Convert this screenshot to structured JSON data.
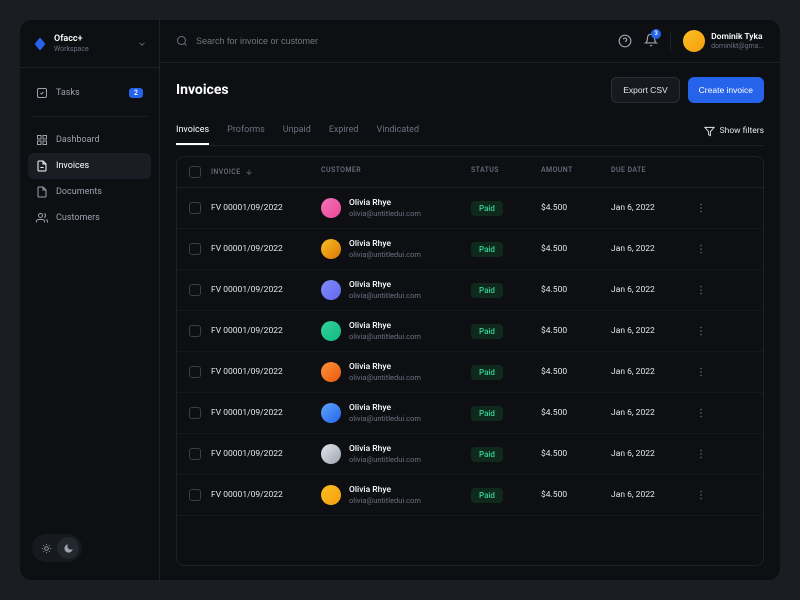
{
  "workspace": {
    "name": "Ofacc+",
    "label": "Workspace"
  },
  "sidebar": {
    "tasks_label": "Tasks",
    "tasks_badge": "2",
    "items": [
      {
        "label": "Dashboard"
      },
      {
        "label": "Invoices"
      },
      {
        "label": "Documents"
      },
      {
        "label": "Customers"
      }
    ]
  },
  "search": {
    "placeholder": "Search for invoice or customer"
  },
  "notifications": {
    "count": "3"
  },
  "user": {
    "name": "Dominik Tyka",
    "email": "dominikt@gma..."
  },
  "page": {
    "title": "Invoices"
  },
  "buttons": {
    "export": "Export CSV",
    "create": "Create invoice",
    "filters": "Show filters"
  },
  "tabs": [
    "Invoices",
    "Proforms",
    "Unpaid",
    "Expired",
    "Vindicated"
  ],
  "table": {
    "headers": {
      "invoice": "INVOICE",
      "customer": "CUSTOMER",
      "status": "STATUS",
      "amount": "AMOUNT",
      "due_date": "DUE DATE"
    },
    "rows": [
      {
        "invoice": "FV 00001/09/2022",
        "customer_name": "Olivia Rhye",
        "customer_email": "olivia@untitledui.com",
        "status": "Paid",
        "amount": "$4.500",
        "due_date": "Jan 6, 2022"
      },
      {
        "invoice": "FV 00001/09/2022",
        "customer_name": "Olivia Rhye",
        "customer_email": "olivia@untitledui.com",
        "status": "Paid",
        "amount": "$4.500",
        "due_date": "Jan 6, 2022"
      },
      {
        "invoice": "FV 00001/09/2022",
        "customer_name": "Olivia Rhye",
        "customer_email": "olivia@untitledui.com",
        "status": "Paid",
        "amount": "$4.500",
        "due_date": "Jan 6, 2022"
      },
      {
        "invoice": "FV 00001/09/2022",
        "customer_name": "Olivia Rhye",
        "customer_email": "olivia@untitledui.com",
        "status": "Paid",
        "amount": "$4.500",
        "due_date": "Jan 6, 2022"
      },
      {
        "invoice": "FV 00001/09/2022",
        "customer_name": "Olivia Rhye",
        "customer_email": "olivia@untitledui.com",
        "status": "Paid",
        "amount": "$4.500",
        "due_date": "Jan 6, 2022"
      },
      {
        "invoice": "FV 00001/09/2022",
        "customer_name": "Olivia Rhye",
        "customer_email": "olivia@untitledui.com",
        "status": "Paid",
        "amount": "$4.500",
        "due_date": "Jan 6, 2022"
      },
      {
        "invoice": "FV 00001/09/2022",
        "customer_name": "Olivia Rhye",
        "customer_email": "olivia@untitledui.com",
        "status": "Paid",
        "amount": "$4.500",
        "due_date": "Jan 6, 2022"
      },
      {
        "invoice": "FV 00001/09/2022",
        "customer_name": "Olivia Rhye",
        "customer_email": "olivia@untitledui.com",
        "status": "Paid",
        "amount": "$4.500",
        "due_date": "Jan 6, 2022"
      }
    ]
  }
}
